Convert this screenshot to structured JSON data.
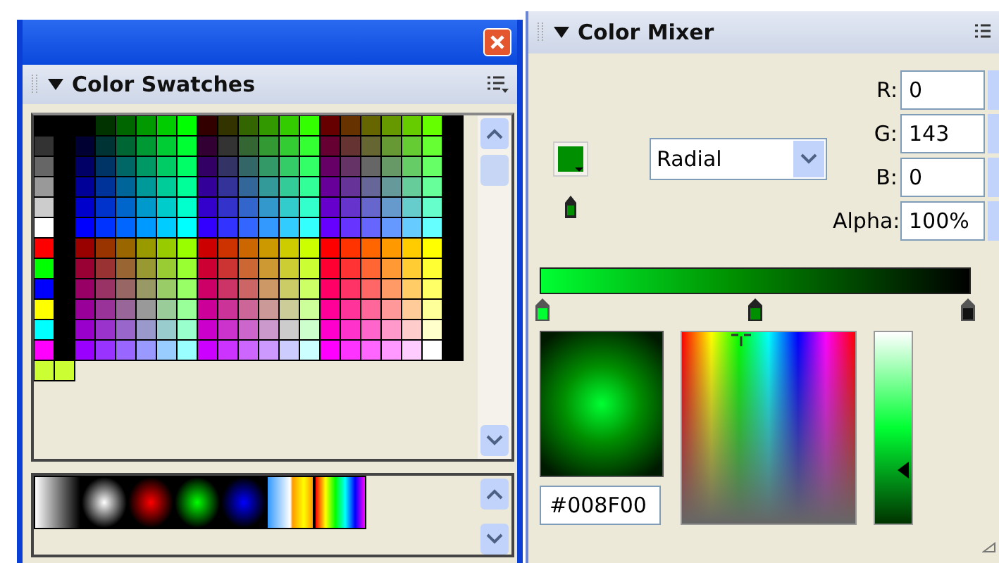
{
  "swatches_panel": {
    "title": "Color Swatches"
  },
  "mixer_panel": {
    "title": "Color Mixer",
    "fill_type": "Radial",
    "channels": [
      {
        "label": "R:",
        "value": "0"
      },
      {
        "label": "G:",
        "value": "143"
      },
      {
        "label": "B:",
        "value": "0"
      },
      {
        "label": "Alpha:",
        "value": "100%"
      }
    ],
    "hex": "#008F00"
  }
}
